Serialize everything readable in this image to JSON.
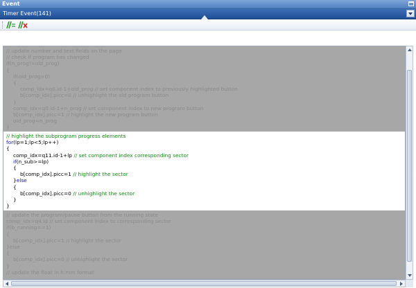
{
  "window": {
    "title": "Event"
  },
  "selector": {
    "selected": "Timer Event(141)"
  },
  "toolbar": {
    "buttons": [
      {
        "name": "add-event-button",
        "icon": "green-slash-plus-icon"
      },
      {
        "name": "delete-event-button",
        "icon": "green-slash-red-x-icon"
      }
    ]
  },
  "code": {
    "block1": [
      {
        "indent": "",
        "parts": [
          {
            "t": "// update number and text fields on the page",
            "k": "cm"
          }
        ]
      },
      {
        "indent": "",
        "parts": [
          {
            "t": "// check if program has changed",
            "k": "cm"
          }
        ]
      },
      {
        "indent": "",
        "parts": [
          {
            "t": "if",
            "k": "kw"
          },
          {
            "t": "(n_prog!=old_prog)",
            "k": ""
          }
        ]
      },
      {
        "indent": "",
        "parts": [
          {
            "t": "{",
            "k": ""
          }
        ]
      },
      {
        "indent": "  ",
        "parts": [
          {
            "t": "if",
            "k": "kw"
          },
          {
            "t": "(old_prog>0)",
            "k": ""
          }
        ]
      },
      {
        "indent": "  ",
        "parts": [
          {
            "t": "{",
            "k": ""
          }
        ]
      },
      {
        "indent": "    ",
        "parts": [
          {
            "t": "comp_idx=q0.id-1+old_prog ",
            "k": ""
          },
          {
            "t": "// set component index to previously highlighted button",
            "k": "cm"
          }
        ]
      },
      {
        "indent": "    ",
        "parts": [
          {
            "t": "b[comp_idx].picc=0 ",
            "k": ""
          },
          {
            "t": "// unhighlight the old program button",
            "k": "cm"
          }
        ]
      },
      {
        "indent": "  ",
        "parts": [
          {
            "t": "}",
            "k": ""
          }
        ]
      },
      {
        "indent": "  ",
        "parts": [
          {
            "t": "comp_idx=q0.id-1+n_prog ",
            "k": ""
          },
          {
            "t": "// set component index to new program button",
            "k": "cm"
          }
        ]
      },
      {
        "indent": "  ",
        "parts": [
          {
            "t": "b[comp_idx].picc=1 ",
            "k": ""
          },
          {
            "t": "// highlight the new program button",
            "k": "cm"
          }
        ]
      },
      {
        "indent": "  ",
        "parts": [
          {
            "t": "old_prog=n_prog",
            "k": ""
          }
        ]
      },
      {
        "indent": "",
        "parts": [
          {
            "t": "}",
            "k": ""
          }
        ]
      }
    ],
    "block2": [
      {
        "indent": "",
        "parts": [
          {
            "t": "// highlight the subprogram progress elements",
            "k": "cm"
          }
        ]
      },
      {
        "indent": "",
        "parts": [
          {
            "t": "for",
            "k": "kw"
          },
          {
            "t": "(lp=1;lp<5;lp++)",
            "k": ""
          }
        ]
      },
      {
        "indent": "",
        "parts": [
          {
            "t": "{",
            "k": ""
          }
        ]
      },
      {
        "indent": "  ",
        "parts": [
          {
            "t": "comp_idx=q11.id-1+lp ",
            "k": ""
          },
          {
            "t": "// set component index corresponding sector",
            "k": "cm"
          }
        ]
      },
      {
        "indent": "  ",
        "parts": [
          {
            "t": "if",
            "k": "kw"
          },
          {
            "t": "(n_sub>=lp)",
            "k": ""
          }
        ]
      },
      {
        "indent": "  ",
        "parts": [
          {
            "t": "{",
            "k": ""
          }
        ]
      },
      {
        "indent": "    ",
        "parts": [
          {
            "t": "b[comp_idx].picc=1 ",
            "k": ""
          },
          {
            "t": "// highlight the sector",
            "k": "cm"
          }
        ]
      },
      {
        "indent": "  ",
        "parts": [
          {
            "t": "}",
            "k": ""
          },
          {
            "t": "else",
            "k": "kw"
          }
        ]
      },
      {
        "indent": "  ",
        "parts": [
          {
            "t": "{",
            "k": ""
          }
        ]
      },
      {
        "indent": "    ",
        "parts": [
          {
            "t": "b[comp_idx].picc=0 ",
            "k": ""
          },
          {
            "t": "// unhighlight the sector",
            "k": "cm"
          }
        ]
      },
      {
        "indent": "  ",
        "parts": [
          {
            "t": "}",
            "k": ""
          }
        ]
      },
      {
        "indent": "",
        "parts": [
          {
            "t": "}",
            "k": ""
          }
        ]
      }
    ],
    "block3": [
      {
        "indent": "",
        "parts": [
          {
            "t": "// update the program/pause button from the running state",
            "k": "cm"
          }
        ]
      },
      {
        "indent": "",
        "parts": [
          {
            "t": "comp_idx=q4.id ",
            "k": ""
          },
          {
            "t": "// set component index to corresponding sector",
            "k": "cm"
          }
        ]
      },
      {
        "indent": "",
        "parts": [
          {
            "t": "if",
            "k": "kw"
          },
          {
            "t": "(b_running==1)",
            "k": ""
          }
        ]
      },
      {
        "indent": "",
        "parts": [
          {
            "t": "{",
            "k": ""
          }
        ]
      },
      {
        "indent": "  ",
        "parts": [
          {
            "t": "b[comp_idx].picc=1 ",
            "k": ""
          },
          {
            "t": "// highlight the sector",
            "k": "cm"
          }
        ]
      },
      {
        "indent": "",
        "parts": [
          {
            "t": "}",
            "k": ""
          },
          {
            "t": "else",
            "k": "kw"
          }
        ]
      },
      {
        "indent": "",
        "parts": [
          {
            "t": "{",
            "k": ""
          }
        ]
      },
      {
        "indent": "  ",
        "parts": [
          {
            "t": "b[comp_idx].picc=0 ",
            "k": ""
          },
          {
            "t": "// unhighlight the sector",
            "k": "cm"
          }
        ]
      },
      {
        "indent": "",
        "parts": [
          {
            "t": "}",
            "k": ""
          }
        ]
      },
      {
        "indent": "",
        "parts": [
          {
            "t": "// update the float in h:mm format",
            "k": "cm"
          }
        ]
      }
    ]
  }
}
